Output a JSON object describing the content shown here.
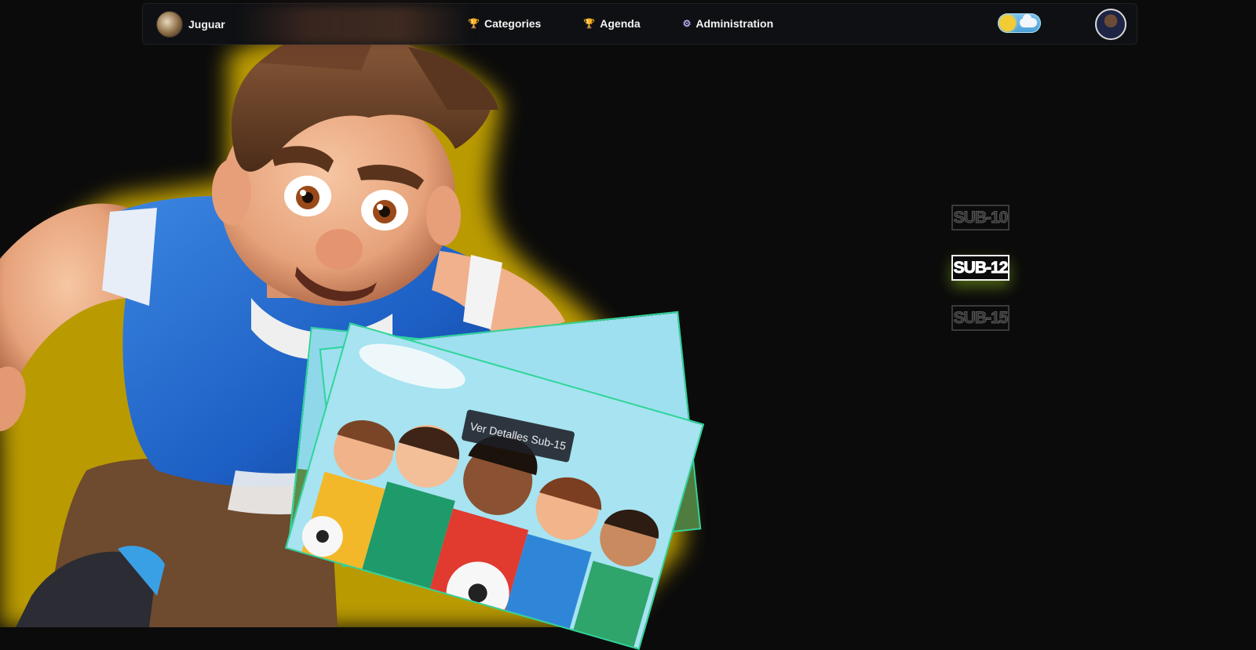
{
  "nav": {
    "brand": "Juguar",
    "links": [
      {
        "label": "Categories",
        "icon": "trophy-icon"
      },
      {
        "label": "Agenda",
        "icon": "trophy-icon"
      },
      {
        "label": "Administration",
        "icon": "gear-icon"
      }
    ],
    "theme_toggle": "light",
    "colors": {
      "accent": "#2fd59a",
      "glow": "#e8c400"
    }
  },
  "categories": [
    {
      "label": "SUB-10",
      "active": false
    },
    {
      "label": "SUB-12",
      "active": true
    },
    {
      "label": "SUB-15",
      "active": false
    }
  ],
  "card": {
    "cta": "Ver Detalles Sub-15"
  }
}
